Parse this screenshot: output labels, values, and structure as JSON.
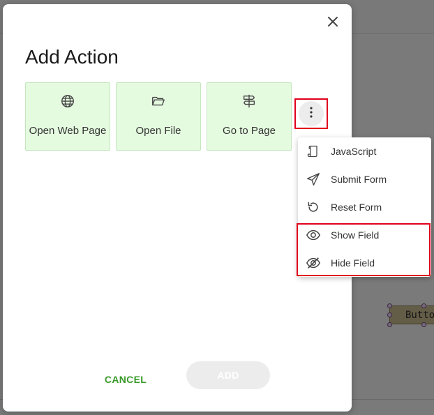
{
  "dialog": {
    "title": "Add Action",
    "cards": [
      {
        "label": "Open Web Page",
        "icon": "globe-icon"
      },
      {
        "label": "Open File",
        "icon": "folder-open-icon"
      },
      {
        "label": "Go to Page",
        "icon": "signpost-icon"
      }
    ],
    "more_icon": "more-vertical-icon",
    "close_icon": "close-icon",
    "cancel_label": "CANCEL",
    "add_label": "ADD"
  },
  "menu": {
    "items": [
      {
        "label": "JavaScript",
        "icon": "script-icon"
      },
      {
        "label": "Submit Form",
        "icon": "send-icon"
      },
      {
        "label": "Reset Form",
        "icon": "reset-icon"
      },
      {
        "label": "Show Field",
        "icon": "eye-icon"
      },
      {
        "label": "Hide Field",
        "icon": "eye-off-icon"
      }
    ]
  },
  "background": {
    "widget_label": "Button"
  },
  "colors": {
    "card_bg": "#e5fbe0",
    "accent_green": "#3a9a2a",
    "highlight_red": "#e0001b"
  }
}
